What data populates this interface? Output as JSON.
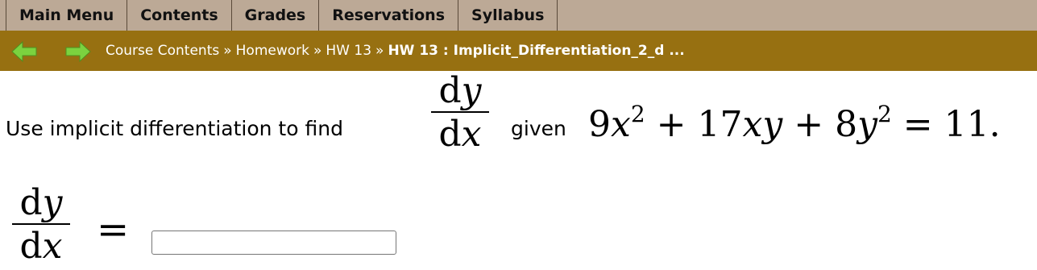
{
  "menu": {
    "items": [
      {
        "label": "Main Menu"
      },
      {
        "label": "Contents"
      },
      {
        "label": "Grades"
      },
      {
        "label": "Reservations"
      },
      {
        "label": "Syllabus"
      }
    ]
  },
  "nav": {
    "back_icon": "left-arrow-icon",
    "forward_icon": "right-arrow-icon",
    "arrow_color": "#7bd23f"
  },
  "breadcrumb": {
    "items": [
      {
        "label": "Course Contents"
      },
      {
        "label": "Homework"
      },
      {
        "label": "HW 13"
      }
    ],
    "separator": "»",
    "current": "HW 13 : Implicit_Differentiation_2_d ..."
  },
  "problem": {
    "lead": "Use implicit differentiation to find",
    "frac_num": "dy",
    "frac_den": "dx",
    "given": "given",
    "equation": {
      "c1": "9",
      "v1": "x",
      "e1": "2",
      "op1": "+",
      "c2": "17",
      "v2": "xy",
      "op2": "+",
      "c3": "8",
      "v3": "y",
      "e3": "2",
      "eq": "=",
      "rhs": "11."
    }
  },
  "answer": {
    "frac_num": "dy",
    "frac_den": "dx",
    "equals": "=",
    "value": ""
  },
  "colors": {
    "menu_bg": "#bca996",
    "breadcrumb_bg": "#977011"
  }
}
